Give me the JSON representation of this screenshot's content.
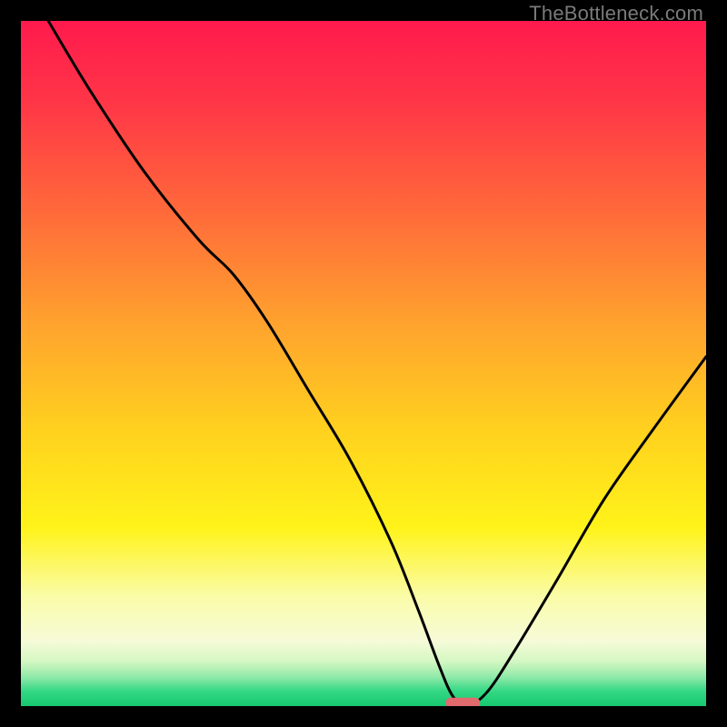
{
  "watermark": "TheBottleneck.com",
  "chart_data": {
    "type": "line",
    "title": "",
    "xlabel": "",
    "ylabel": "",
    "xlim": [
      0,
      100
    ],
    "ylim": [
      0,
      100
    ],
    "background_gradient_stops": [
      {
        "pos": 0.0,
        "color": "#ff1a4d"
      },
      {
        "pos": 0.12,
        "color": "#ff3647"
      },
      {
        "pos": 0.28,
        "color": "#ff6a3a"
      },
      {
        "pos": 0.44,
        "color": "#ffa22e"
      },
      {
        "pos": 0.6,
        "color": "#ffd21e"
      },
      {
        "pos": 0.74,
        "color": "#fff31a"
      },
      {
        "pos": 0.84,
        "color": "#fafca8"
      },
      {
        "pos": 0.905,
        "color": "#f6fbd8"
      },
      {
        "pos": 0.935,
        "color": "#d4f7c2"
      },
      {
        "pos": 0.958,
        "color": "#8ee9a8"
      },
      {
        "pos": 0.978,
        "color": "#34d885"
      },
      {
        "pos": 1.0,
        "color": "#17c870"
      }
    ],
    "series": [
      {
        "name": "bottleneck-curve",
        "x": [
          4.0,
          10.0,
          18.0,
          26.0,
          31.0,
          36.0,
          42.0,
          48.0,
          54.0,
          58.0,
          61.0,
          63.0,
          65.0,
          68.0,
          72.0,
          78.0,
          85.0,
          92.0,
          100.0
        ],
        "y": [
          100.0,
          90.0,
          78.0,
          68.0,
          63.0,
          56.0,
          46.0,
          36.0,
          24.0,
          14.0,
          6.0,
          1.5,
          0.0,
          2.0,
          8.0,
          18.0,
          30.0,
          40.0,
          51.0
        ]
      }
    ],
    "marker": {
      "name": "optimal-range",
      "x_center": 64.5,
      "y": 0.5,
      "width": 5.0,
      "color": "#e06a6e"
    }
  }
}
